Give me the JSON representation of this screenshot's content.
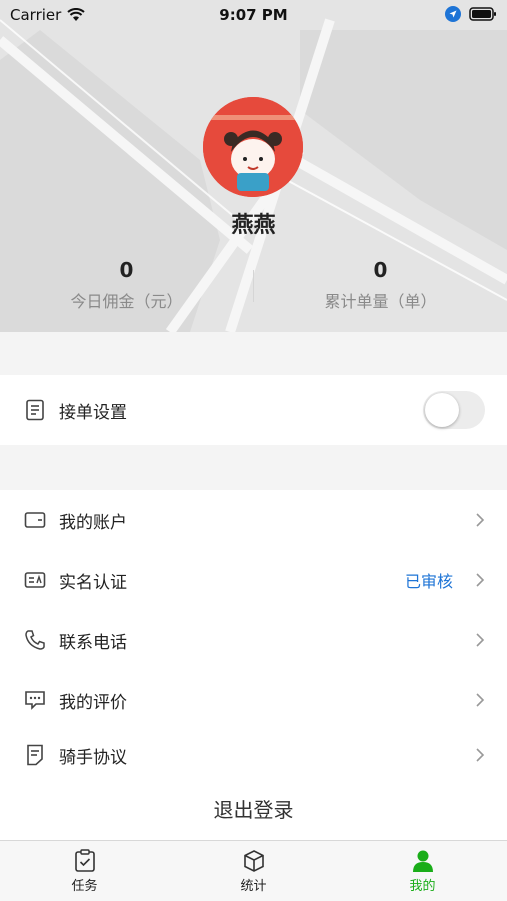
{
  "status_bar": {
    "carrier": "Carrier",
    "time": "9:07 PM"
  },
  "profile": {
    "name": "燕燕",
    "stats": [
      {
        "value": "0",
        "label": "今日佣金（元）"
      },
      {
        "value": "0",
        "label": "累计单量（单）"
      }
    ]
  },
  "settings_row": {
    "label": "接单设置",
    "toggle_on": false
  },
  "menu": [
    {
      "label": "我的账户",
      "icon": "wallet-icon",
      "status": ""
    },
    {
      "label": "实名认证",
      "icon": "id-card-icon",
      "status": "已审核"
    },
    {
      "label": "联系电话",
      "icon": "phone-icon",
      "status": ""
    },
    {
      "label": "我的评价",
      "icon": "comment-icon",
      "status": ""
    },
    {
      "label": "骑手协议",
      "icon": "document-icon",
      "status": ""
    }
  ],
  "logout_label": "退出登录",
  "tabbar": [
    {
      "label": "任务",
      "icon": "clipboard-icon",
      "active": false
    },
    {
      "label": "统计",
      "icon": "box-icon",
      "active": false
    },
    {
      "label": "我的",
      "icon": "person-icon",
      "active": true
    }
  ],
  "colors": {
    "accent_green": "#1aad19",
    "link_blue": "#1e74d6"
  }
}
